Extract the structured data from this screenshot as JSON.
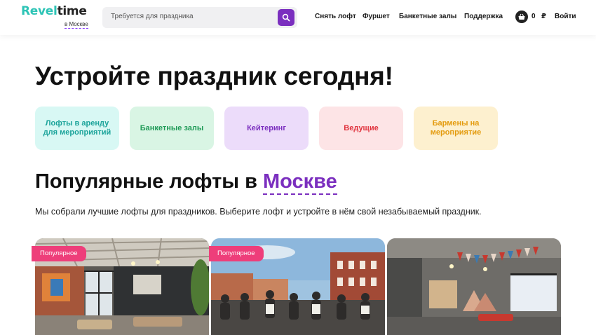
{
  "header": {
    "logo": {
      "part1": "Revel",
      "part2": "time",
      "city": "в Москве"
    },
    "search": {
      "placeholder": "Требуется для праздника"
    },
    "nav": [
      "Снять лофт",
      "Фуршет",
      "Банкетные залы",
      "Поддержка"
    ],
    "cart": {
      "count": "0",
      "currency": "₽"
    },
    "login": "Войти"
  },
  "hero": {
    "title": "Устройте праздник сегодня!"
  },
  "categories": [
    {
      "label": "Лофты в аренду для мероприятий",
      "bg": "#d8f8f4",
      "color": "#1aa39a"
    },
    {
      "label": "Банкетные залы",
      "bg": "#d9f5e4",
      "color": "#1f9a57"
    },
    {
      "label": "Кейтеринг",
      "bg": "#ecdcfa",
      "color": "#7b2fbf"
    },
    {
      "label": "Ведущие",
      "bg": "#fde4e6",
      "color": "#e0313c"
    },
    {
      "label": "Бармены на мероприятие",
      "bg": "#fdf0cf",
      "color": "#e39a0c"
    }
  ],
  "popular": {
    "title_prefix": "Популярные лофты в",
    "title_city": "Москве",
    "description": "Мы собрали лучшие лофты для праздников. Выберите лофт и устройте в нём свой незабываемый праздник.",
    "cards": [
      {
        "badge": "Популярное"
      },
      {
        "badge": "Популярное"
      },
      {
        "badge": ""
      }
    ]
  },
  "colors": {
    "accent": "#7b2fbf",
    "badge": "#ee3e7a",
    "brand_teal": "#2ec4b6"
  },
  "icons": {
    "search": "search-icon",
    "cart": "basket-icon"
  }
}
